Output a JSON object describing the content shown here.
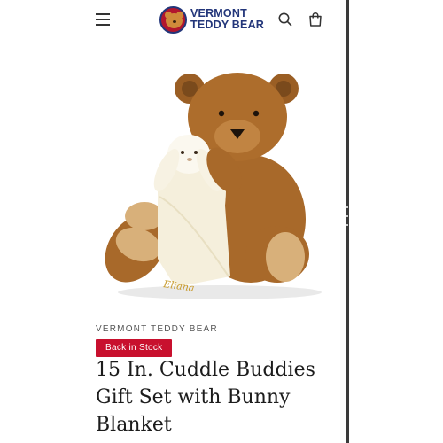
{
  "header": {
    "logo_line1": "VERMONT",
    "logo_line2": "TEDDY BEAR",
    "menu_icon": "hamburger-menu-icon",
    "search_icon": "search-icon",
    "cart_icon": "shopping-bag-icon"
  },
  "product": {
    "image_name": "product-image-teddy-bear-with-bunny-blanket",
    "blanket_embroidery": "Eliana",
    "vendor": "VERMONT TEDDY BEAR",
    "stock_badge": "Back in Stock",
    "title": "15 In. Cuddle Buddies Gift Set with Bunny Blanket"
  },
  "colors": {
    "brand_navy": "#23367a",
    "brand_red": "#c8102e",
    "bear_brown": "#a8692a",
    "blanket_cream": "#f5efdc"
  }
}
